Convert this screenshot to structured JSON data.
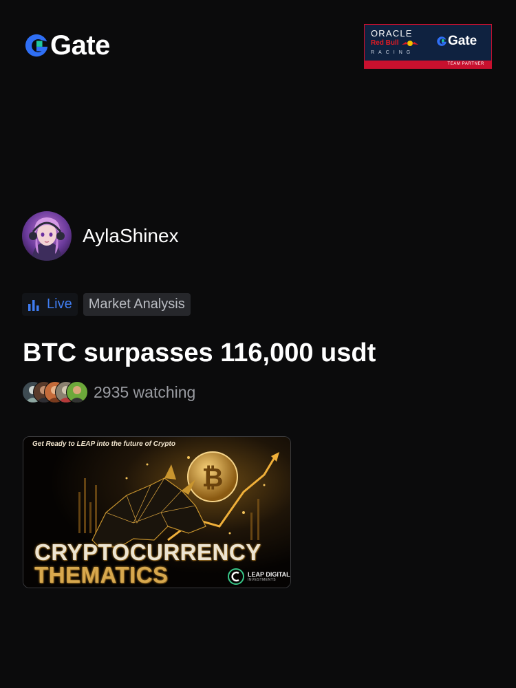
{
  "brand": {
    "name": "Gate",
    "accent": "#2f6ff5",
    "accent_green": "#1fc7a0",
    "logo_icon": "gate-logo-icon"
  },
  "partner_banner": {
    "oracle": "ORACLE",
    "red_bull": "Red Bull",
    "racing": "RACING",
    "gate": "Gate",
    "team_partner": "TEAM PARTNER",
    "colors": {
      "bg": "#0f2240",
      "red": "#c8102e"
    }
  },
  "author": {
    "name": "AylaShinex",
    "avatar_icon": "avatar-image"
  },
  "tags": {
    "live": "Live",
    "live_color": "#3f7cf0",
    "live_icon": "bar-chart-icon",
    "category": "Market Analysis"
  },
  "post": {
    "title": "BTC surpasses 116,000 usdt"
  },
  "watching": {
    "count_text": "2935 watching",
    "viewer_avatars": 5
  },
  "thumbnail": {
    "top_text": "Get Ready to LEAP into the future of Crypto",
    "headline_1": "CRYPTOCURRENCY",
    "headline_2": "THEMATICS",
    "brand_1": "LEAP DIGITAL",
    "brand_2": "INVESTMENTS",
    "coin_icon": "bitcoin-icon",
    "accent": "#d7a84e"
  }
}
